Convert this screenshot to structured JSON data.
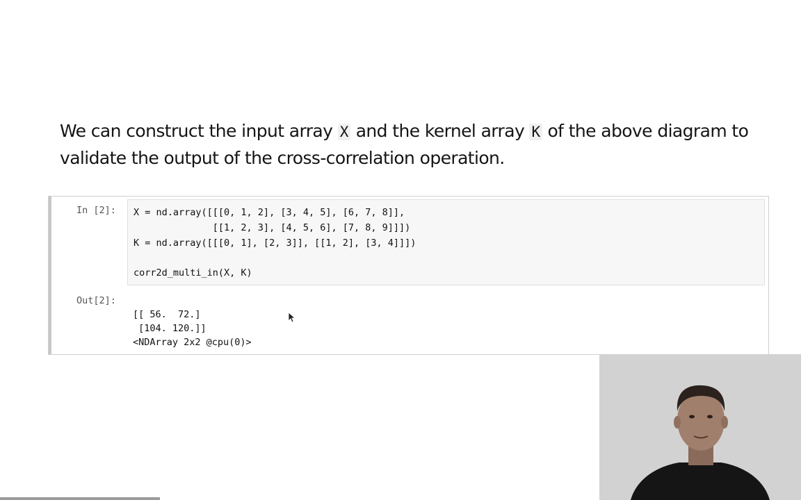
{
  "paragraph": {
    "text_before_x": "We can construct the input array ",
    "code_x": "X",
    "text_between": " and the kernel array ",
    "code_k": "K",
    "text_after": " of the above diagram to validate the output of the cross-correlation operation."
  },
  "cell": {
    "in_prompt": "In [2]:",
    "code_lines": [
      "X = nd.array([[[0, 1, 2], [3, 4, 5], [6, 7, 8]],",
      "              [[1, 2, 3], [4, 5, 6], [7, 8, 9]]])",
      "K = nd.array([[[0, 1], [2, 3]], [[1, 2], [3, 4]]])",
      "",
      "corr2d_multi_in(X, K)"
    ],
    "out_prompt": "Out[2]:",
    "output_lines": [
      "[[ 56.  72.]",
      " [104. 120.]]",
      "<NDArray 2x2 @cpu(0)>"
    ]
  },
  "playback": {
    "progress": 0.2
  }
}
